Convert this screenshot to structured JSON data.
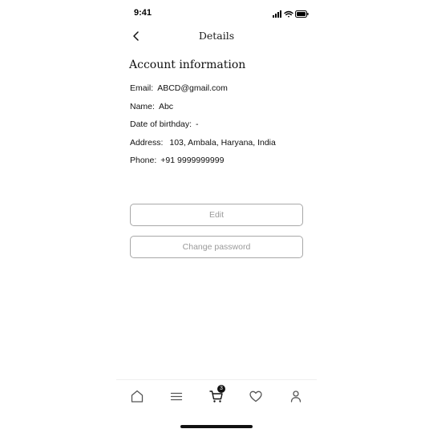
{
  "status_bar": {
    "time": "9:41"
  },
  "header": {
    "title": "Details",
    "back_icon": "chevron-left-icon"
  },
  "account": {
    "section_title": "Account information",
    "fields": [
      {
        "label": "Email:",
        "value": "ABCD@gmail.com"
      },
      {
        "label": "Name:",
        "value": "Abc"
      },
      {
        "label": "Date of birthday:",
        "value": "-"
      },
      {
        "label": "Address:",
        "value": " 103, Ambala, Haryana, India"
      },
      {
        "label": "Phone:",
        "value": "+91 9999999999"
      }
    ]
  },
  "actions": {
    "edit_label": "Edit",
    "change_password_label": "Change password"
  },
  "bottom_nav": {
    "items": [
      {
        "icon": "home-icon"
      },
      {
        "icon": "menu-icon"
      },
      {
        "icon": "cart-icon",
        "badge": "3"
      },
      {
        "icon": "heart-icon"
      },
      {
        "icon": "profile-icon"
      }
    ]
  },
  "colors": {
    "button_border": "#a8a8a8",
    "button_text": "#9a9a9a",
    "text": "#111111"
  }
}
